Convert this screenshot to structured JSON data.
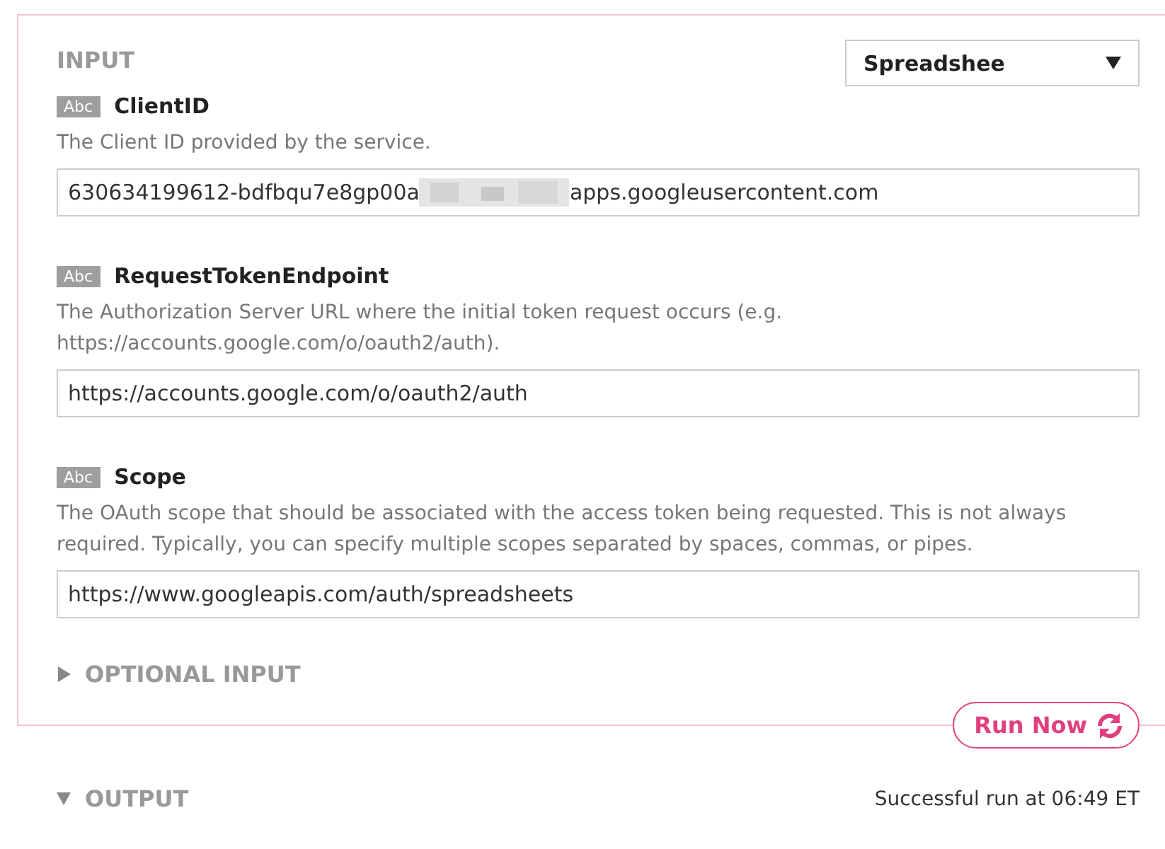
{
  "input_section": {
    "title": "INPUT",
    "dropdown": {
      "value": "Spreadshee"
    },
    "fields": [
      {
        "type_badge": "Abc",
        "label": "ClientID",
        "description": "The Client ID provided by the service.",
        "value_start": "630634199612-bdfbqu7e8gp00a",
        "redacted": true,
        "value_end": "apps.googleusercontent.com"
      },
      {
        "type_badge": "Abc",
        "label": "RequestTokenEndpoint",
        "description": "The Authorization Server URL where the initial token request occurs (e.g. https://accounts.google.com/o/oauth2/auth).",
        "value_start": "https://accounts.google.com/o/oauth2/auth"
      },
      {
        "type_badge": "Abc",
        "label": "Scope",
        "description": "The OAuth scope that should be associated with the access token being requested. This is not always required. Typically, you can specify multiple scopes separated by spaces, commas, or pipes.",
        "value_start": "https://www.googleapis.com/auth/spreadsheets"
      }
    ],
    "optional": {
      "title": "OPTIONAL INPUT",
      "expanded": false
    }
  },
  "run_button": {
    "label": "Run Now"
  },
  "output_section": {
    "title": "OUTPUT",
    "expanded": true,
    "status": "Successful run at 06:49 ET"
  }
}
